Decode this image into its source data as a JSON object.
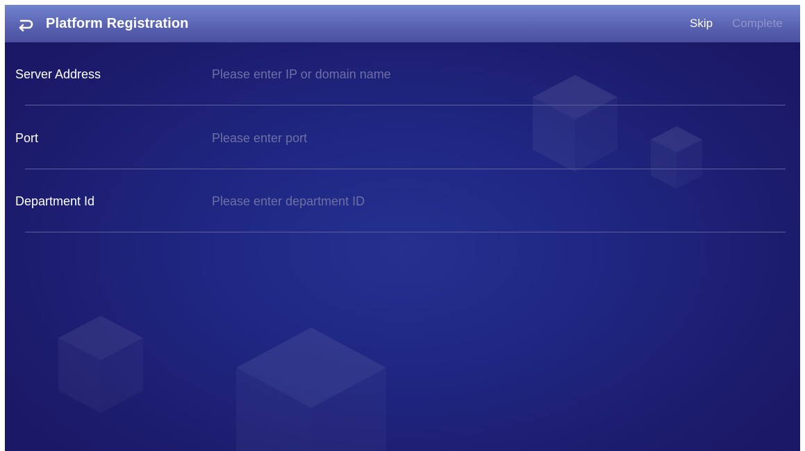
{
  "header": {
    "back_icon": "back-arrow-icon",
    "title": "Platform Registration",
    "skip_label": "Skip",
    "complete_label": "Complete"
  },
  "form": {
    "fields": [
      {
        "label": "Server Address",
        "placeholder": "Please enter IP or domain name",
        "value": ""
      },
      {
        "label": "Port",
        "placeholder": "Please enter port",
        "value": ""
      },
      {
        "label": "Department Id",
        "placeholder": "Please enter department ID",
        "value": ""
      }
    ]
  },
  "colors": {
    "header_top": "#7283cf",
    "header_bottom": "#4b4f9f",
    "background": "#1f2782",
    "placeholder": "#6d70a4",
    "complete_disabled": "#8f95c9"
  }
}
